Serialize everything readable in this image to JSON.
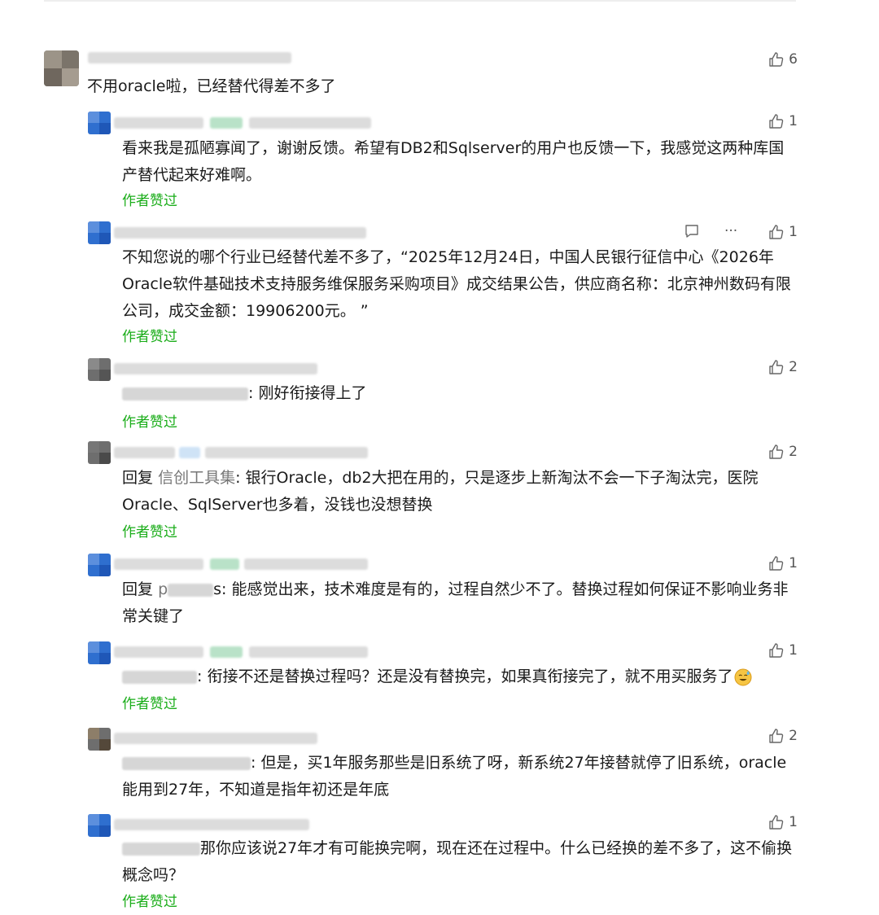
{
  "comments": [
    {
      "text": "不用oracle啦，已经替代得差不多了",
      "likes": "6",
      "replies": [
        {
          "text": "看来我是孤陋寡闻了，谢谢反馈。希望有DB2和Sqlserver的用户也反馈一下，我感觉这两种库国产替代起来好难啊。",
          "likes": "1",
          "author_liked": "作者赞过"
        },
        {
          "text": "不知您说的哪个行业已经替代差不多了，“2025年12月24日，中国人民银行征信中心《2026年Oracle软件基础技术支持服务维保服务采购项目》成交结果公告，供应商名称：北京神州数码有限公司，成交金额：19906200元。 ”",
          "likes": "1",
          "author_liked": "作者赞过"
        },
        {
          "text": ": 刚好衔接得上了",
          "likes": "2",
          "author_liked": "作者赞过"
        },
        {
          "reply_prefix": "回复",
          "reply_to": "信创工具集",
          "text": ": 银行Oracle，db2大把在用的，只是逐步上新淘汰不会一下子淘汰完，医院Oracle、SqlServer也多着，没钱也没想替换",
          "likes": "2",
          "author_liked": "作者赞过"
        },
        {
          "reply_prefix": "回复",
          "reply_to": "p",
          "text": "s: 能感觉出来，技术难度是有的，过程自然少不了。替换过程如何保证不影响业务非常关键了",
          "likes": "1"
        },
        {
          "text": ": 衔接不还是替换过程吗？还是没有替换完，如果真衔接完了，就不用买服务了",
          "likes": "1",
          "author_liked": "作者赞过"
        },
        {
          "text": ": 但是，买1年服务那些是旧系统了呀，新系统27年接替就停了旧系统，oracle能用到27年，不知道是指年初还是年底",
          "likes": "2"
        },
        {
          "text": "那你应该说27年才有可能换完啊，现在还在过程中。什么已经换的差不多了，这不偷换概念吗？",
          "likes": "1",
          "author_liked": "作者赞过"
        }
      ]
    }
  ],
  "actions": {
    "more": "···"
  },
  "colors": {
    "author_liked": "#1aad19",
    "avatar_blue": "#2f6fcf"
  },
  "icons": {
    "like": "thumbs-up-icon",
    "comment": "comment-icon",
    "emoji": "sweat-smile-emoji"
  }
}
